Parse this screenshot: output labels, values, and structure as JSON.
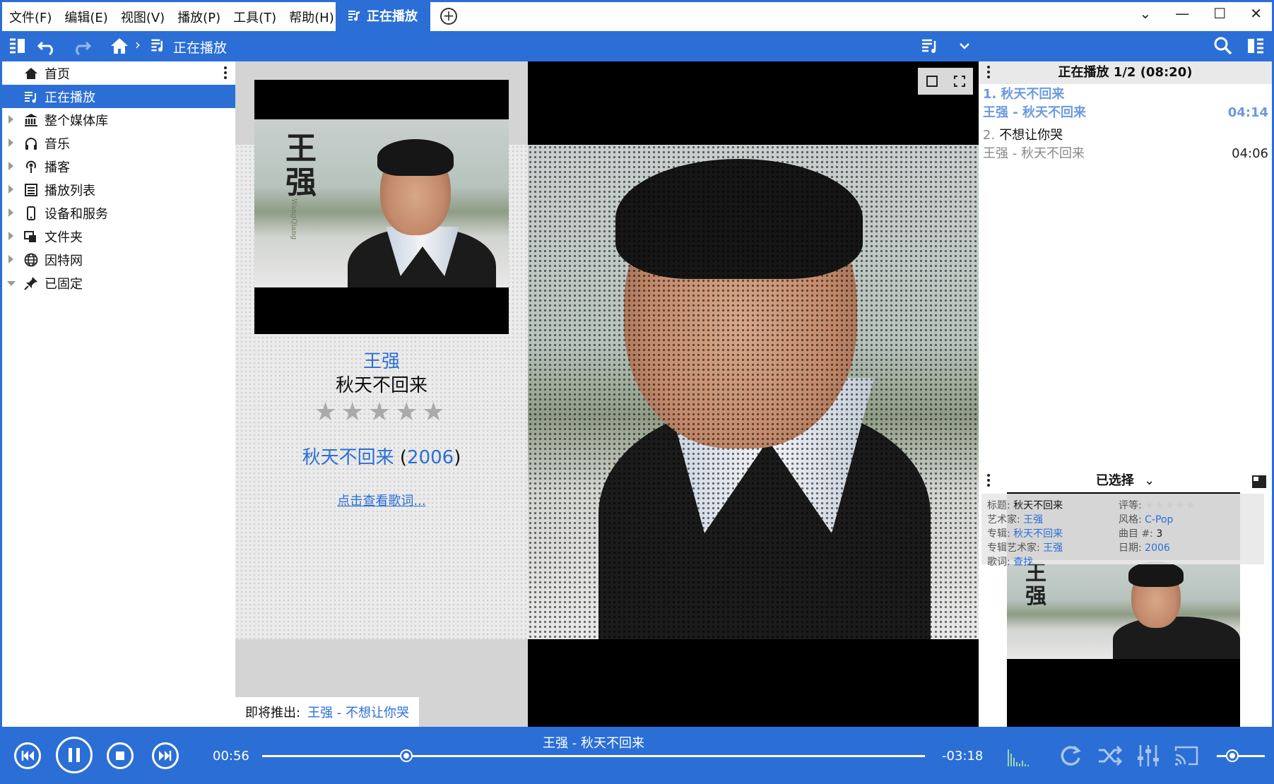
{
  "menu": [
    "文件(F)",
    "编辑(E)",
    "视图(V)",
    "播放(P)",
    "工具(T)",
    "帮助(H)"
  ],
  "active_tab": "正在播放",
  "breadcrumb": {
    "current": "正在播放"
  },
  "colors": {
    "accent": "#2b6fd6",
    "link": "#2b6fd6",
    "current_track": "#6d99e0"
  },
  "sidebar": {
    "items": [
      {
        "label": "首页",
        "icon": "home-icon",
        "expander": "none",
        "active": false
      },
      {
        "label": "正在播放",
        "icon": "now-playing-icon",
        "expander": "none",
        "active": true
      },
      {
        "label": "整个媒体库",
        "icon": "library-icon",
        "expander": "right",
        "active": false
      },
      {
        "label": "音乐",
        "icon": "headphones-icon",
        "expander": "right",
        "active": false
      },
      {
        "label": "播客",
        "icon": "podcast-icon",
        "expander": "right",
        "active": false
      },
      {
        "label": "播放列表",
        "icon": "playlist-icon",
        "expander": "right",
        "active": false
      },
      {
        "label": "设备和服务",
        "icon": "device-icon",
        "expander": "right",
        "active": false
      },
      {
        "label": "文件夹",
        "icon": "folder-icon",
        "expander": "right",
        "active": false
      },
      {
        "label": "因特网",
        "icon": "globe-icon",
        "expander": "right",
        "active": false
      },
      {
        "label": "已固定",
        "icon": "pin-icon",
        "expander": "down",
        "active": false
      }
    ]
  },
  "info": {
    "artist": "王强",
    "title": "秋天不回来",
    "rating": "★★★★★",
    "album": "秋天不回来",
    "year_open": "(",
    "year": "2006",
    "year_close": ")",
    "lyrics_link": "点击查看歌词...",
    "upnext_label": "即将推出:",
    "upnext_value": "王强 - 不想让你哭"
  },
  "now_playing": {
    "header": "正在播放 1/2 (08:20)",
    "tracks": [
      {
        "num": "1.",
        "title": "秋天不回来",
        "subtitle": "王强 - 秋天不回来",
        "duration": "04:14"
      },
      {
        "num": "2.",
        "title": "不想让你哭",
        "subtitle": "王强 - 秋天不回来",
        "duration": "04:06"
      }
    ]
  },
  "selected": {
    "header": "已选择",
    "fields": {
      "title_label": "标题:",
      "title_value": "秋天不回来",
      "artist_label": "艺术家:",
      "artist_value": "王强",
      "album_label": "专辑:",
      "album_value": "秋天不回来",
      "album_artist_label": "专辑艺术家:",
      "album_artist_value": "王强",
      "lyrics_label": "歌词:",
      "lyrics_value": "查找",
      "rating_label": "评等:",
      "rating_value": "★★★★★",
      "genre_label": "风格:",
      "genre_value": "C-Pop",
      "track_label": "曲目 #:",
      "track_value": "3",
      "date_label": "日期:",
      "date_value": "2006"
    }
  },
  "player": {
    "track": "王强 - 秋天不回来",
    "elapsed": "00:56",
    "remaining": "-03:18",
    "progress": 0.218,
    "volume": 0.33
  },
  "cover_text": {
    "chars": "王强",
    "latin": "WangQiang"
  }
}
